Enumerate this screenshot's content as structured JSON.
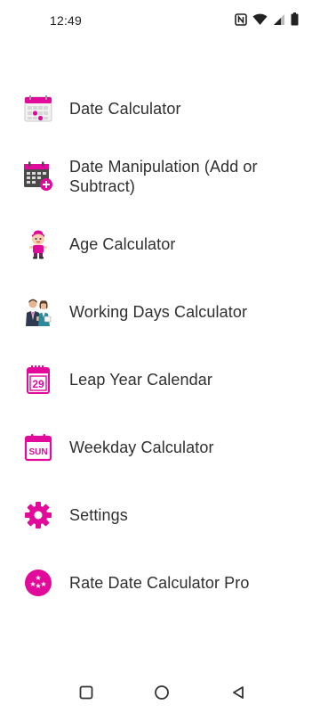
{
  "status_bar": {
    "time": "12:49",
    "icons": [
      "nfc-icon",
      "wifi-icon",
      "signal-icon",
      "battery-icon"
    ]
  },
  "menu": {
    "accent_color": "#E20A9A",
    "items": [
      {
        "label": "Date Calculator",
        "icon": "calendar-icon"
      },
      {
        "label": "Date Manipulation (Add or Subtract)",
        "icon": "calendar-add-icon"
      },
      {
        "label": "Age Calculator",
        "icon": "baby-icon"
      },
      {
        "label": "Working Days Calculator",
        "icon": "workers-icon"
      },
      {
        "label": "Leap Year Calendar",
        "icon": "calendar-29-icon"
      },
      {
        "label": "Weekday Calculator",
        "icon": "calendar-sun-icon"
      },
      {
        "label": "Settings",
        "icon": "gear-icon"
      },
      {
        "label": "Rate Date Calculator Pro",
        "icon": "rate-stars-icon"
      }
    ]
  },
  "calendar_29_text": "29",
  "calendar_sun_text": "SUN",
  "nav_bar": {
    "buttons": [
      "recents-button",
      "home-button",
      "back-button"
    ]
  }
}
